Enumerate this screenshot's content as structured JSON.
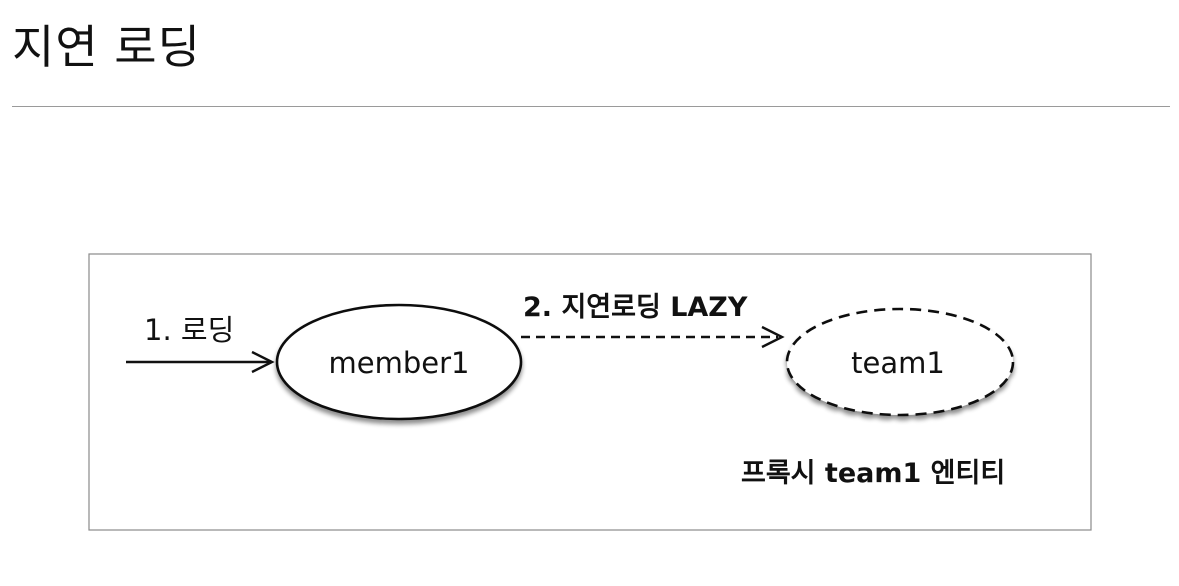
{
  "page": {
    "title": "지연 로딩"
  },
  "diagram": {
    "step1_label": "1. 로딩",
    "step2_label": "2. 지연로딩 LAZY",
    "nodes": {
      "member": "member1",
      "team": "team1"
    },
    "proxy_caption": "프록시 team1 엔티티"
  }
}
